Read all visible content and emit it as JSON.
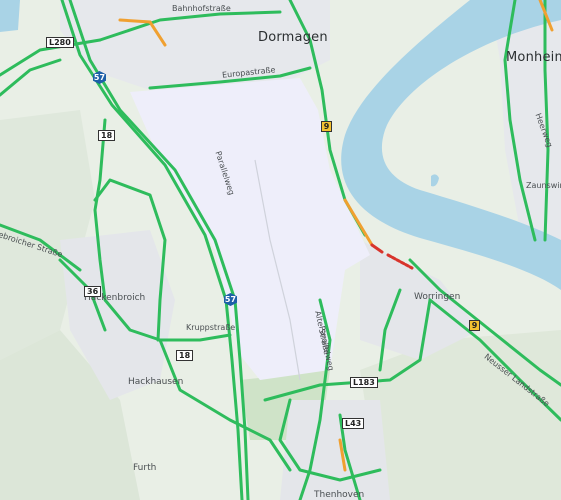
{
  "map": {
    "places": {
      "dormagen": "Dormagen",
      "monheim": "Monheim a",
      "hackenbroich": "Hackenbroich",
      "hackhausen": "Hackhausen",
      "worringen": "Worringen",
      "furth": "Furth",
      "thenhoven": "Thenhoven"
    },
    "streets": {
      "bahnhofstrasse": "Bahnhofstraße",
      "europastrasse": "Europastraße",
      "parallelweg_top": "Parallelweg",
      "parallelweg_bottom": "Parallelweg",
      "krupp": "Kruppstraße",
      "alte": "Alte Straße",
      "neusser": "Neusser Landstraße",
      "broicher": "ebroicher Straße",
      "heerweg": "Heerweg",
      "zauns": "Zaunswink"
    },
    "shields": {
      "l280": "L280",
      "a57_top": "57",
      "a57_mid": "57",
      "r18_top": "18",
      "r18_bottom": "18",
      "r36": "36",
      "b9_top": "9",
      "b9_right": "9",
      "l183": "L183",
      "l43": "L43"
    },
    "colors": {
      "land": "#e9efe6",
      "industrial": "#eeeefa",
      "water": "#a9d3e6",
      "traffic_free": "#2ebc5c",
      "traffic_slow": "#f0a030",
      "traffic_jam": "#d8342c",
      "autobahn_shield": "#1d5fa8",
      "federal_shield": "#f4c230"
    }
  }
}
